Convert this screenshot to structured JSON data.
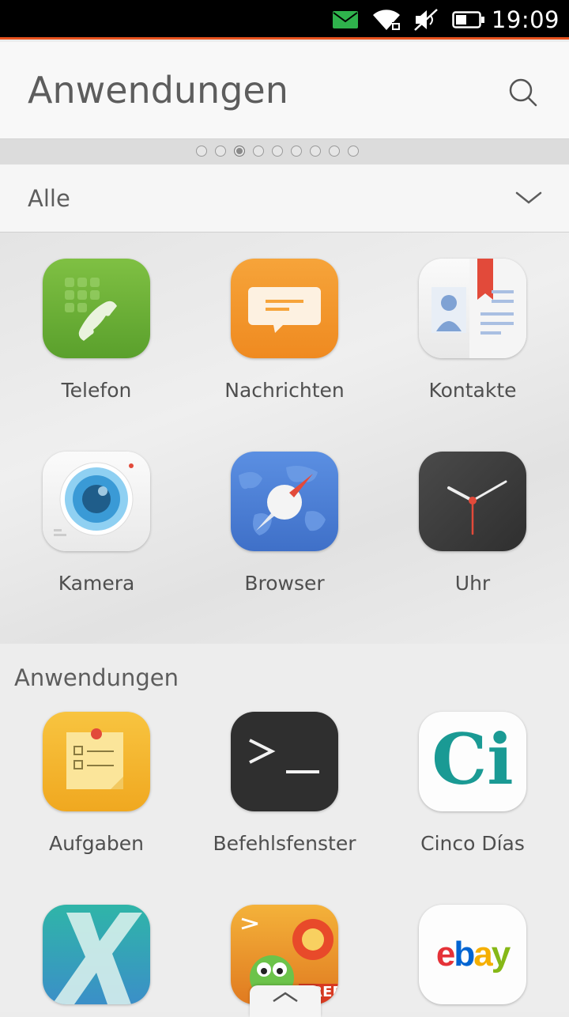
{
  "status": {
    "time": "19:09",
    "icons": [
      "message-icon",
      "wifi-icon",
      "muted-speaker-icon",
      "battery-icon"
    ]
  },
  "header": {
    "title": "Anwendungen",
    "search_icon": "search-icon"
  },
  "pager": {
    "count": 9,
    "active_index": 2
  },
  "filter": {
    "value": "Alle"
  },
  "favorites": [
    {
      "label": "Telefon",
      "icon": "phone-icon"
    },
    {
      "label": "Nachrichten",
      "icon": "messages-icon"
    },
    {
      "label": "Kontakte",
      "icon": "contacts-icon"
    },
    {
      "label": "Kamera",
      "icon": "camera-icon"
    },
    {
      "label": "Browser",
      "icon": "browser-icon"
    },
    {
      "label": "Uhr",
      "icon": "clock-icon"
    }
  ],
  "apps_section": {
    "title": "Anwendungen",
    "apps": [
      {
        "label": "Aufgaben",
        "icon": "tasks-icon"
      },
      {
        "label": "Befehlsfenster",
        "icon": "terminal-icon"
      },
      {
        "label": "Cinco Días",
        "icon": "cinco-dias-icon",
        "logo_text": "Ci"
      },
      {
        "label": "",
        "icon": "x-app-icon"
      },
      {
        "label": "",
        "icon": "cut-the-rope-icon",
        "badge": "FREE"
      },
      {
        "label": "",
        "icon": "ebay-icon",
        "logo_text": "ebay"
      }
    ]
  },
  "colors": {
    "accent": "#e95420",
    "phone": "#6fb33c",
    "messages": "#f39a2c",
    "browser": "#4a7fd6",
    "clock": "#3e3e3e",
    "tasks": "#f5b830",
    "terminal": "#2f2f2f",
    "cinco": "#1a9a94"
  }
}
